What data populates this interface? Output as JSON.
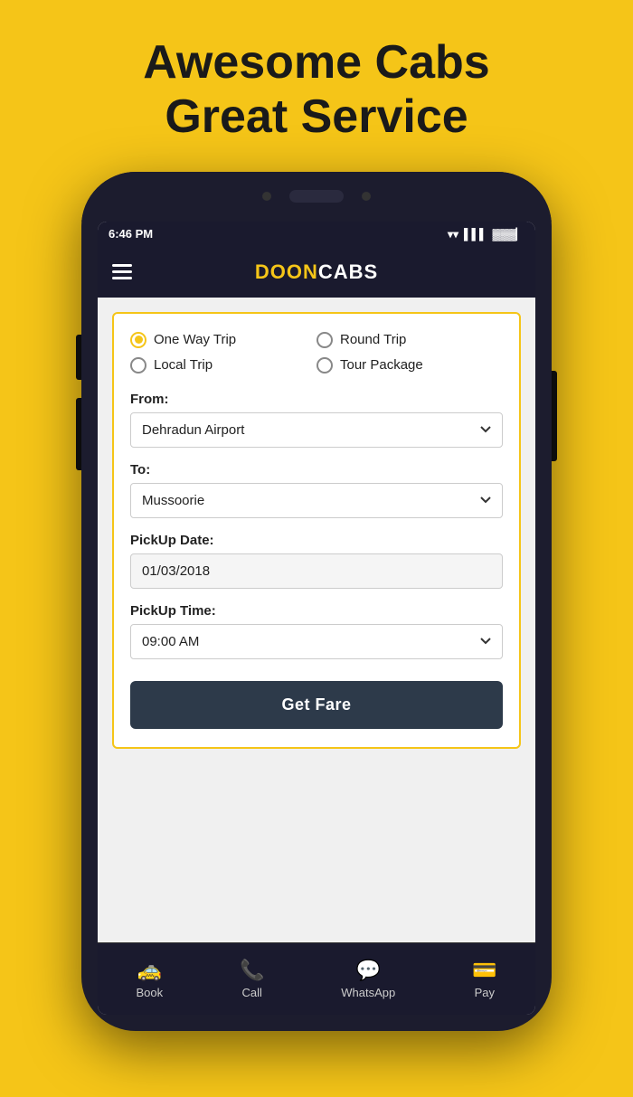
{
  "hero": {
    "line1": "Awesome Cabs",
    "line2": "Great Service"
  },
  "status_bar": {
    "time": "6:46 PM",
    "wifi": "wifi",
    "signal": "signal",
    "battery": "battery"
  },
  "header": {
    "logo_yellow": "DOON",
    "logo_white": "CABS"
  },
  "trip_types": [
    {
      "id": "one_way",
      "label": "One Way Trip",
      "selected": true
    },
    {
      "id": "round",
      "label": "Round Trip",
      "selected": false
    },
    {
      "id": "local",
      "label": "Local Trip",
      "selected": false
    },
    {
      "id": "tour",
      "label": "Tour Package",
      "selected": false
    }
  ],
  "form": {
    "from_label": "From:",
    "from_value": "Dehradun Airport",
    "to_label": "To:",
    "to_value": "Mussoorie",
    "pickup_date_label": "PickUp Date:",
    "pickup_date_value": "01/03/2018",
    "pickup_time_label": "PickUp Time:",
    "pickup_time_value": "09:00 AM",
    "submit_label": "Get Fare"
  },
  "bottom_nav": [
    {
      "id": "book",
      "label": "Book",
      "icon": "🚕"
    },
    {
      "id": "call",
      "label": "Call",
      "icon": "📞"
    },
    {
      "id": "whatsapp",
      "label": "WhatsApp",
      "icon": "💬"
    },
    {
      "id": "pay",
      "label": "Pay",
      "icon": "💳"
    }
  ]
}
